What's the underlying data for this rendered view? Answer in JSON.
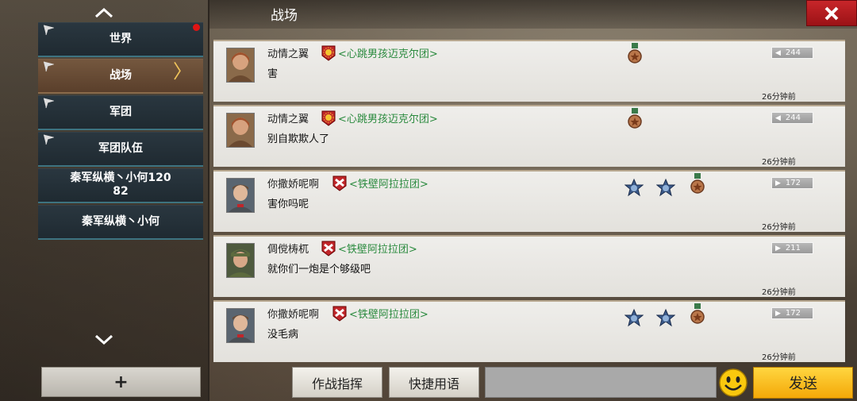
{
  "header": {
    "title": "战场",
    "close_icon": "close-x-icon"
  },
  "sidebar": {
    "channels": [
      {
        "label": "世界",
        "unread": true
      },
      {
        "label": "战场",
        "active": true
      },
      {
        "label": "军团"
      },
      {
        "label": "军团队伍"
      },
      {
        "label": "秦军纵横丶小何120\n82"
      },
      {
        "label": "秦军纵横丶小何"
      }
    ],
    "add_label": "+"
  },
  "messages": [
    {
      "user": "动情之翼",
      "legion": "<心跳男孩迈克尔团>",
      "text": "害",
      "rank": "244",
      "time": "26分钟前"
    },
    {
      "user": "动情之翼",
      "legion": "<心跳男孩迈克尔团>",
      "text": "别自欺欺人了",
      "rank": "244",
      "time": "26分钟前"
    },
    {
      "user": "你撒娇呢啊",
      "legion": "<铁壁阿拉拉团>",
      "text": "害你吗呢",
      "rank": "172",
      "time": "26分钟前"
    },
    {
      "user": "倜傥梼杌",
      "legion": "<铁壁阿拉拉团>",
      "text": "就你们一炮是个够级吧",
      "rank": "211",
      "time": "26分钟前"
    },
    {
      "user": "你撒娇呢啊",
      "legion": "<铁壁阿拉拉团>",
      "text": "没毛病",
      "rank": "172",
      "time": "26分钟前"
    }
  ],
  "bottom": {
    "command_label": "作战指挥",
    "quick_phrase_label": "快捷用语",
    "send_label": "发送",
    "emoji_icon": "smiley-icon"
  },
  "colors": {
    "legion_text": "#2a8a3e",
    "send_button": "#f4a808",
    "close_button": "#c8262a",
    "active_channel": "#75583f"
  }
}
